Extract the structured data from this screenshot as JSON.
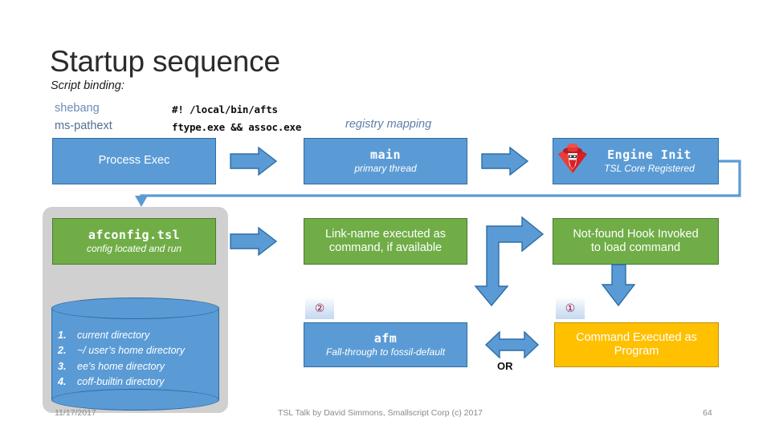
{
  "slide": {
    "title": "Startup sequence",
    "subtitle": "Script binding:",
    "registry_mapping_label": "registry mapping"
  },
  "script_binding": {
    "rows": [
      {
        "label": "shebang",
        "code": "#! /local/bin/afts"
      },
      {
        "label": "ms-pathext",
        "code": "ftype.exe && assoc.exe"
      }
    ]
  },
  "flow": {
    "row1": [
      {
        "id": "process-exec",
        "title": "Process Exec",
        "subtitle": "",
        "color": "#5b9bd5"
      },
      {
        "id": "main",
        "title": "main",
        "subtitle": "primary thread",
        "color": "#5b9bd5"
      },
      {
        "id": "engine-init",
        "title": "Engine Init",
        "subtitle": "TSL Core Registered",
        "color": "#5b9bd5"
      }
    ],
    "row2": [
      {
        "id": "afconfig",
        "title": "afconfig.tsl",
        "subtitle": "config located and run",
        "color": "#70ad47"
      },
      {
        "id": "link-name",
        "title": "Link-name executed as",
        "subtitle2": "command, if available",
        "color": "#70ad47"
      },
      {
        "id": "not-found-hook",
        "title": "Not-found Hook Invoked",
        "subtitle2": "to load command",
        "color": "#70ad47"
      }
    ],
    "row3": [
      {
        "id": "afm",
        "title": "afm",
        "subtitle": "Fall-through to fossil-default",
        "color": "#5b9bd5"
      },
      {
        "id": "command-program",
        "title": "Command Executed as",
        "subtitle2": "Program",
        "color": "#ffc000"
      }
    ]
  },
  "directory_search": {
    "items": [
      {
        "num": "1.",
        "text": "current directory"
      },
      {
        "num": "2.",
        "text": "~/ user’s home directory"
      },
      {
        "num": "3.",
        "text": "ee’s home directory"
      },
      {
        "num": "4.",
        "text": "coff-builtin directory"
      }
    ]
  },
  "badges": {
    "step_two": "②",
    "step_one": "①"
  },
  "connectors": {
    "or_label": "OR"
  },
  "footer": {
    "date": "11/17/2017",
    "center": "TSL Talk by David Simmons, Smallscript Corp (c) 2017",
    "page": "64"
  },
  "colors": {
    "blue": "#5b9bd5",
    "blue_border": "#2e6ca4",
    "green": "#70ad47",
    "green_border": "#4b7a2e",
    "amber": "#ffc000",
    "amber_border": "#bf8f00",
    "gray_panel": "#d0d0d0",
    "label_blue": "#6a8bb5",
    "badge_red": "#9d1b44"
  }
}
